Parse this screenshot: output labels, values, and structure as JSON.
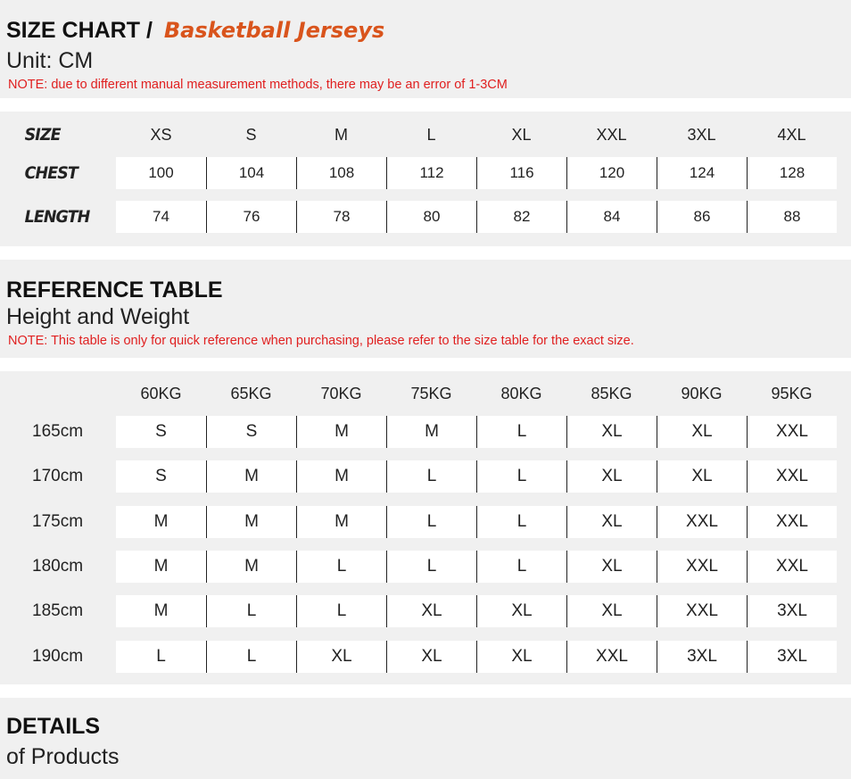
{
  "size_chart": {
    "title": "SIZE CHART",
    "slash": "/",
    "product": "Basketball Jerseys",
    "unit": "Unit: CM",
    "note": "NOTE: due to different manual measurement methods, there may be an error of 1-3CM",
    "header_label": "SIZE",
    "sizes": [
      "XS",
      "S",
      "M",
      "L",
      "XL",
      "XXL",
      "3XL",
      "4XL"
    ],
    "rows": [
      {
        "label": "CHEST",
        "values": [
          "100",
          "104",
          "108",
          "112",
          "116",
          "120",
          "124",
          "128"
        ]
      },
      {
        "label": "LENGTH",
        "values": [
          "74",
          "76",
          "78",
          "80",
          "82",
          "84",
          "86",
          "88"
        ]
      }
    ]
  },
  "reference_table": {
    "title": "REFERENCE TABLE",
    "subtitle": "Height and Weight",
    "note": "NOTE: This table is only for quick reference when purchasing, please refer to the size table for the exact size.",
    "weights": [
      "60KG",
      "65KG",
      "70KG",
      "75KG",
      "80KG",
      "85KG",
      "90KG",
      "95KG"
    ],
    "rows": [
      {
        "height": "165cm",
        "values": [
          "S",
          "S",
          "M",
          "M",
          "L",
          "XL",
          "XL",
          "XXL"
        ]
      },
      {
        "height": "170cm",
        "values": [
          "S",
          "M",
          "M",
          "L",
          "L",
          "XL",
          "XL",
          "XXL"
        ]
      },
      {
        "height": "175cm",
        "values": [
          "M",
          "M",
          "M",
          "L",
          "L",
          "XL",
          "XXL",
          "XXL"
        ]
      },
      {
        "height": "180cm",
        "values": [
          "M",
          "M",
          "L",
          "L",
          "L",
          "XL",
          "XXL",
          "XXL"
        ]
      },
      {
        "height": "185cm",
        "values": [
          "M",
          "L",
          "L",
          "XL",
          "XL",
          "XL",
          "XXL",
          "3XL"
        ]
      },
      {
        "height": "190cm",
        "values": [
          "L",
          "L",
          "XL",
          "XL",
          "XL",
          "XXL",
          "3XL",
          "3XL"
        ]
      }
    ]
  },
  "details": {
    "title": "DETAILS",
    "subtitle": "of Products"
  }
}
